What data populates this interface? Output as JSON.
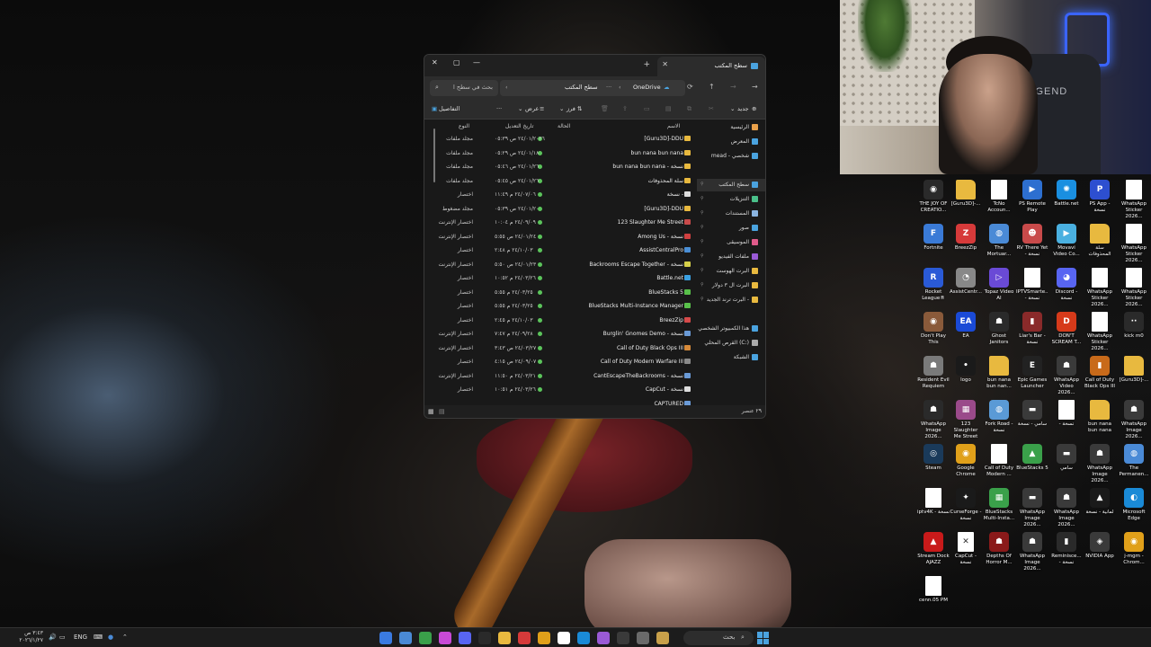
{
  "window": {
    "title": "سطح المكتب",
    "controls": {
      "minimize": "—",
      "maximize": "▢",
      "close": "✕"
    },
    "new_tab": "+",
    "address": {
      "crumb1": "OneDrive",
      "crumb2": "سطح المكتب",
      "more": "···"
    },
    "search_placeholder": "بحث في سطح ا",
    "toolbar": {
      "new": "جديد",
      "sort": "فرز",
      "view": "عرض",
      "more": "···",
      "details": "التفاصيل"
    },
    "columns": {
      "name": "الاسم",
      "status": "الحالة",
      "date": "تاريخ التعديل",
      "type": "النوع"
    },
    "files": [
      {
        "name": "[Guru3D]-DDU",
        "date": "٢٤/٠١/٢٠٢٦ ص ٠٥:٣٩",
        "type": "مجلد ملفات",
        "color": "#e8b93f"
      },
      {
        "name": "bun nana bun nana",
        "date": "٢٤/٠١/١٨ ص ٠٥:٢٩",
        "type": "مجلد ملفات",
        "color": "#e8b93f"
      },
      {
        "name": "bun nana bun nana - نسخة",
        "date": "٢٤/٠١/٢٦ ص ٠٥:٤٦",
        "type": "مجلد ملفات",
        "color": "#e8b93f"
      },
      {
        "name": "سلة المحذوفات",
        "date": "٢٤/٠١/٢٦ ص ٠٥:٤٥",
        "type": "مجلد ملفات",
        "color": "#e8b93f"
      },
      {
        "name": "نسخة -",
        "date": "٢٤/٠٧/٠٦ م ١١:٤٩",
        "type": "اختصار",
        "color": "#dddddd"
      },
      {
        "name": "[Guru3D]-DDU",
        "date": "٢٤/٠١/٢٠ ص ٠٥:٣٩",
        "type": "مجلد مضغوط",
        "color": "#e8b93f"
      },
      {
        "name": "123 Slaughter Me Street",
        "date": "٢٤/٠٩/٠٩ م ١٠:٠٤",
        "type": "اختصار الإنترنت",
        "color": "#c84a4a"
      },
      {
        "name": "Among Us - نسخة",
        "date": "٢٤/٠١/٢٤ ص ٥:٥٥",
        "type": "اختصار الإنترنت",
        "color": "#d04040"
      },
      {
        "name": "AssistCentralPro",
        "date": "٢٤/١٠/٠٣ م ٢:٤٨",
        "type": "اختصار",
        "color": "#4a8fd6"
      },
      {
        "name": "Backrooms Escape Together - نسخة",
        "date": "٢٤/٠١/٢٣ ص ٥:٥٠",
        "type": "اختصار الإنترنت",
        "color": "#d6d04a"
      },
      {
        "name": "Battle.net",
        "date": "٢٤/٠٣/٢٦ م ١٠:٥٢",
        "type": "اختصار",
        "color": "#3aa0e0"
      },
      {
        "name": "BlueStacks 5",
        "date": "٢٤/٠٣/٢٥ م ٥:٥٥",
        "type": "اختصار",
        "color": "#58c04a"
      },
      {
        "name": "BlueStacks Multi-Instance Manager",
        "date": "٢٤/٠٣/٢٥ م ٥:٥٥",
        "type": "اختصار",
        "color": "#58c04a"
      },
      {
        "name": "BreezZip",
        "date": "٢٤/١٠/٠٣ م ٢:٤٥",
        "type": "اختصار",
        "color": "#d64a4a"
      },
      {
        "name": "Burglin' Gnomes Demo - نسخة",
        "date": "٢٤/٠٩/٢٨ م ٧:٤٧",
        "type": "اختصار الإنترنت",
        "color": "#6a9ad6"
      },
      {
        "name": "Call of Duty Black Ops III",
        "date": "٢٤/٠٣/٢٧ ص ٣:٤٣",
        "type": "اختصار الإنترنت",
        "color": "#d68a3a"
      },
      {
        "name": "Call of Duty Modern Warfare III",
        "date": "٢٤/٠٩/٠٧ ص ٤:١٥",
        "type": "اختصار",
        "color": "#8a8a8a"
      },
      {
        "name": "CantEscapeTheBackrooms - نسخة",
        "date": "٢٤/٠٣/٢١ م ١١:٥٠",
        "type": "اختصار الإنترنت",
        "color": "#6a9ad6"
      },
      {
        "name": "CapCut - نسخة",
        "date": "٢٤/٠٣/٢٦ م ١٠:٥١",
        "type": "اختصار",
        "color": "#dddddd"
      },
      {
        "name": "CAPTURED",
        "date": "",
        "type": "",
        "color": "#6a9ad6"
      }
    ],
    "nav": [
      {
        "label": "الرئيسية",
        "color": "#e8a04a"
      },
      {
        "label": "المعرض",
        "color": "#4aa3df"
      },
      {
        "label": "mead - شخصي",
        "color": "#4aa3df"
      },
      {
        "label": "سطح المكتب",
        "color": "#4aa3df"
      },
      {
        "label": "التنزيلات",
        "color": "#4ac08a"
      },
      {
        "label": "المستندات",
        "color": "#8ab4e0"
      },
      {
        "label": "صور",
        "color": "#4aa3df"
      },
      {
        "label": "الموسيقى",
        "color": "#e05a8a"
      },
      {
        "label": "ملفات الفيديو",
        "color": "#9a5ad6"
      },
      {
        "label": "البرت الهوست",
        "color": "#e8b93f"
      },
      {
        "label": "البرت ال ٣ دولار",
        "color": "#e8b93f"
      },
      {
        "label": "البرت ترند الجديد -",
        "color": "#e8b93f"
      },
      {
        "label": "هذا الكمبيوتر الشخصي",
        "color": "#4aa3df"
      },
      {
        "label": "القرص المحلي (C:)",
        "color": "#aaaaaa"
      },
      {
        "label": "الشبكة",
        "color": "#4aa3df"
      }
    ],
    "item_count": "٢٩ عنصر"
  },
  "webcam": {
    "chair_text": "LEGEND"
  },
  "desktop_icons": [
    {
      "label": "THE JOY OF CREATIO...",
      "color": "#2a2a2a",
      "glyph": "◉"
    },
    {
      "label": "[Guru3D]-...",
      "color": "#e8b93f",
      "glyph": ""
    },
    {
      "label": "TcNo Accoun...",
      "color": "#ffffff",
      "glyph": ""
    },
    {
      "label": "PS Remote Play",
      "color": "#2d6fd0",
      "glyph": "▶"
    },
    {
      "label": "Battle.net",
      "color": "#1a8fe0",
      "glyph": "✺"
    },
    {
      "label": "PS App - نسخة",
      "color": "#2d4fd0",
      "glyph": "P"
    },
    {
      "label": "WhatsApp Sticker 2026...",
      "color": "#ffffff",
      "glyph": ""
    },
    {
      "label": "Fortnite",
      "color": "#3a7ad6",
      "glyph": "F"
    },
    {
      "label": "BreezZip",
      "color": "#d63a3a",
      "glyph": "Z"
    },
    {
      "label": "The Mortuar...",
      "color": "#4a8ad6",
      "glyph": "◍"
    },
    {
      "label": "RV There Yet - نسخة",
      "color": "#c84a4a",
      "glyph": "☻"
    },
    {
      "label": "Movavi Video Co...",
      "color": "#4ab0e0",
      "glyph": "▶"
    },
    {
      "label": "سلة المحذوفات",
      "color": "#e8b93f",
      "glyph": ""
    },
    {
      "label": "WhatsApp Sticker 2026...",
      "color": "#ffffff",
      "glyph": ""
    },
    {
      "label": "Rocket League®",
      "color": "#2a5ad6",
      "glyph": "R"
    },
    {
      "label": "AssistCentr...",
      "color": "#888888",
      "glyph": "◔"
    },
    {
      "label": "Topaz Video AI",
      "color": "#6a4ad6",
      "glyph": "▷"
    },
    {
      "label": "IPTVSmarte... - نسخة",
      "color": "#ffffff",
      "glyph": ""
    },
    {
      "label": "Discord - نسخة",
      "color": "#5865f2",
      "glyph": "◕"
    },
    {
      "label": "WhatsApp Sticker 2026...",
      "color": "#ffffff",
      "glyph": ""
    },
    {
      "label": "WhatsApp Sticker 2026...",
      "color": "#ffffff",
      "glyph": ""
    },
    {
      "label": "Don't Play This",
      "color": "#8a5a3a",
      "glyph": "◉"
    },
    {
      "label": "EA",
      "color": "#1a4ad6",
      "glyph": "EA"
    },
    {
      "label": "Ghost Janitors",
      "color": "#2a2a2a",
      "glyph": "☗"
    },
    {
      "label": "Liar's Bar - نسخة",
      "color": "#8a2a2a",
      "glyph": "▮"
    },
    {
      "label": "DON'T SCREAM T...",
      "color": "#d63a1a",
      "glyph": "D"
    },
    {
      "label": "WhatsApp Sticker 2026...",
      "color": "#ffffff",
      "glyph": ""
    },
    {
      "label": "kick m0",
      "color": "#2a2a2a",
      "glyph": "··"
    },
    {
      "label": "Resident Evil Requiem",
      "color": "#7a7a7a",
      "glyph": "☗"
    },
    {
      "label": "logo",
      "color": "#1a1a1a",
      "glyph": "•"
    },
    {
      "label": "bun nana bun nan...",
      "color": "#e8b93f",
      "glyph": ""
    },
    {
      "label": "Epic Games Launcher",
      "color": "#222222",
      "glyph": "E"
    },
    {
      "label": "WhatsApp Video 2026...",
      "color": "#3a3a3a",
      "glyph": "☗"
    },
    {
      "label": "Call of Duty Black Ops III",
      "color": "#c86a1a",
      "glyph": "▮"
    },
    {
      "label": "[Guru3D]-...",
      "color": "#e8b93f",
      "glyph": ""
    },
    {
      "label": "WhatsApp Image 2026...",
      "color": "#2a2a2a",
      "glyph": "☗"
    },
    {
      "label": "123 Slaughter Me Street",
      "color": "#9a4a8a",
      "glyph": "▦"
    },
    {
      "label": "Fork Road - نسخة",
      "color": "#5a9ad6",
      "glyph": "◍"
    },
    {
      "label": "سامي - نسخة",
      "color": "#3a3a3a",
      "glyph": "▬"
    },
    {
      "label": "- نسخة",
      "color": "#ffffff",
      "glyph": ""
    },
    {
      "label": "bun nana bun nana",
      "color": "#e8b93f",
      "glyph": ""
    },
    {
      "label": "WhatsApp Image 2026...",
      "color": "#3a3a3a",
      "glyph": "☗"
    },
    {
      "label": "Steam",
      "color": "#1a3a5a",
      "glyph": "◎"
    },
    {
      "label": "Google Chrome",
      "color": "#e0a01a",
      "glyph": "◉"
    },
    {
      "label": "Call of Duty Modern ...",
      "color": "#ffffff",
      "glyph": ""
    },
    {
      "label": "BlueStacks 5",
      "color": "#3aa04a",
      "glyph": "▲"
    },
    {
      "label": "سامي",
      "color": "#3a3a3a",
      "glyph": "▬"
    },
    {
      "label": "WhatsApp Image 2026...",
      "color": "#3a3a3a",
      "glyph": "☗"
    },
    {
      "label": "The Permanen...",
      "color": "#4a8ad6",
      "glyph": "◍"
    },
    {
      "label": "iptv4K - نسخة",
      "color": "#ffffff",
      "glyph": ""
    },
    {
      "label": "CurseForge - نسخة",
      "color": "#1a1a1a",
      "glyph": "✦"
    },
    {
      "label": "BlueStacks Multi-Insta...",
      "color": "#3aa04a",
      "glyph": "▦"
    },
    {
      "label": "WhatsApp Image 2026...",
      "color": "#3a3a3a",
      "glyph": "▬"
    },
    {
      "label": "WhatsApp Image 2026...",
      "color": "#3a3a3a",
      "glyph": "☗"
    },
    {
      "label": "لمانية - نسخة",
      "color": "#1a1a1a",
      "glyph": "▲"
    },
    {
      "label": "Microsoft Edge",
      "color": "#1a8ad6",
      "glyph": "◐"
    },
    {
      "label": "Stream Dock AJAZZ",
      "color": "#c81a1a",
      "glyph": "▲"
    },
    {
      "label": "CapCut - نسخة",
      "color": "#ffffff",
      "glyph": "✕"
    },
    {
      "label": "Depths Of Horror M...",
      "color": "#8a1a1a",
      "glyph": "☗"
    },
    {
      "label": "WhatsApp Image 2026...",
      "color": "#3a3a3a",
      "glyph": "☗"
    },
    {
      "label": "Reminisce... - نسخة",
      "color": "#2a2a2a",
      "glyph": "▮"
    },
    {
      "label": "NVIDIA App",
      "color": "#3a3a3a",
      "glyph": "◈"
    },
    {
      "label": "j-mgm - Chrom...",
      "color": "#e0a01a",
      "glyph": "◉"
    },
    {
      "label": "cenn.05 PM",
      "color": "#ffffff",
      "glyph": ""
    }
  ],
  "taskbar": {
    "time": "٣:٤٣ ص",
    "date": "٢٠٢٦/١/٢٧",
    "lang": "ENG",
    "search": "بحث",
    "apps": [
      "#3a7ae0",
      "#4a8ad6",
      "#3aa04a",
      "#c84ad6",
      "#5865f2",
      "#2a2a2a",
      "#e8b93f",
      "#d63a3a",
      "#e0a01a",
      "#ffffff",
      "#1a8ad6",
      "#9a5ad6",
      "#3a3a3a",
      "#6a6a6a",
      "#c8a04a"
    ]
  }
}
